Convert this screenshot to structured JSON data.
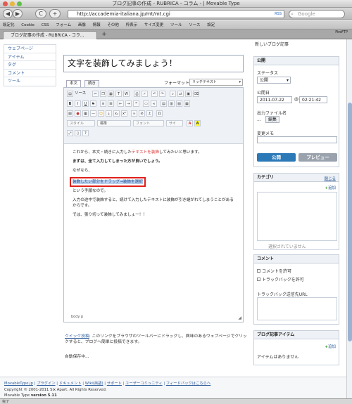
{
  "window": {
    "title": "ブログ記事の作成 - RUBRICA - コラム - | Movable Type"
  },
  "toolbar": {
    "back": "◀",
    "forward": "▶",
    "reload": "C",
    "add": "+",
    "url": "http://accademia-italiana.jp/mt/mt.cgi",
    "search_placeholder": "Google",
    "rss": "RSS"
  },
  "bookmarks": [
    "既定化",
    "Cookie",
    "CSS",
    "フォーム",
    "画像",
    "情報",
    "その他",
    "枠表示",
    "サイズ変更",
    "ツール",
    "ソース",
    "設定"
  ],
  "firefttp": "FireFTP",
  "tabs": [
    {
      "label": "ブログ記事の作成 - RUBRICA - コラ..."
    }
  ],
  "leftnav": {
    "items": [
      "ウェブページ",
      "アイテム",
      "タグ",
      "コメント",
      "ツール"
    ]
  },
  "entry": {
    "title": "文字を装飾してみましょう！"
  },
  "editor": {
    "tab_body": "本文",
    "tab_more": "続き",
    "format_label": "フォーマット:",
    "format_value": "リッチテキスト",
    "source_label": "ソース",
    "style_select": "スタイル",
    "size_select": "標準",
    "font_select": "フォント",
    "fontsize_select": "サイ",
    "paragraphs": {
      "p1_pre": "これから、本文・続きに入力した",
      "p1_red": "テキストを装飾",
      "p1_post": "してみたいと思います。",
      "p2": "まずは、全て入力してしまった方が良いでしょう。",
      "p3": "なぜなら、",
      "p4_sel": "装飾したい部分をドラッグ→装飾を選択",
      "p5": "という手順なので。",
      "p6": "入力の途中で装飾すると、続けて入力したテキストに装飾が引き継がれてしまうことがあるからです。",
      "p7": "では、張り切って装飾してみましょー！！"
    },
    "statusbar": "body   p"
  },
  "publish": {
    "top_text": "新しいブログ記事",
    "header": "公開",
    "status_label": "ステータス",
    "status_value": "公開",
    "date_label": "公開日",
    "date": "2011-07-22",
    "time": "02:21:42",
    "filename_label": "出力ファイル名",
    "filename_value": "...",
    "edit_btn": "編集",
    "memo_label": "変更メモ",
    "publish_btn": "公開",
    "preview_btn": "プレビュー"
  },
  "category": {
    "header": "カテゴリ",
    "hide": "閉じる",
    "add": "追加",
    "empty": "選択されていません"
  },
  "comment": {
    "header": "コメント",
    "allow_comments": "コメントを許可",
    "allow_trackbacks": "トラックバックを許可",
    "trackback_label": "トラックバック送信先URL"
  },
  "items": {
    "header": "ブログ記事アイテム",
    "add": "追加",
    "empty": "アイテムはありません"
  },
  "quick": {
    "link": "クイック投稿",
    "text": ": このリンクをブラウザのツールバーにドラッグし、興味のあるウェブページでクリックすると、ブログへ簡単に投稿できます。"
  },
  "autosave": "自動保存中...",
  "footer": {
    "links": [
      "MovableType.jp",
      "プラグイン",
      "ドキュメント",
      "Wiki(英語)",
      "サポート",
      "ユーザーコミュニティ",
      "フィードバックはこちらへ"
    ],
    "copyright": "Copyright © 2001-2011 Six Apart. All Rights Reserved.",
    "version_prefix": "Movable Type ",
    "version": "version 5.11"
  },
  "statusbar": "完了"
}
